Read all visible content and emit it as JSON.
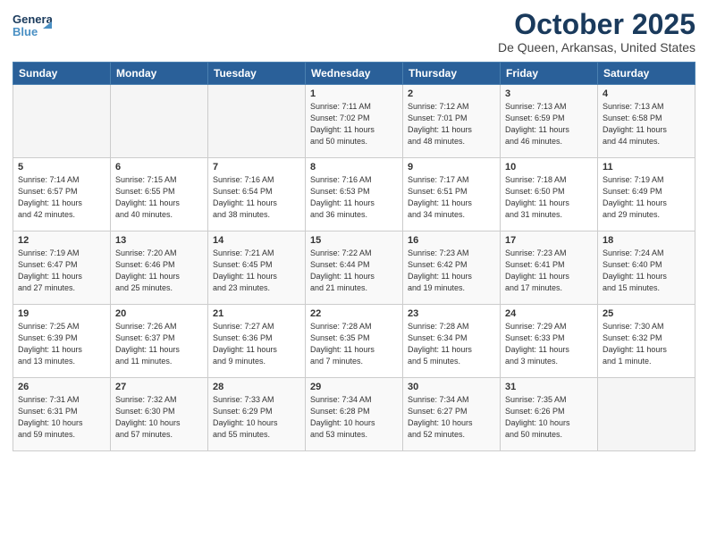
{
  "header": {
    "logo_line1": "General",
    "logo_line2": "Blue",
    "month": "October 2025",
    "location": "De Queen, Arkansas, United States"
  },
  "days_of_week": [
    "Sunday",
    "Monday",
    "Tuesday",
    "Wednesday",
    "Thursday",
    "Friday",
    "Saturday"
  ],
  "weeks": [
    [
      {
        "day": "",
        "info": ""
      },
      {
        "day": "",
        "info": ""
      },
      {
        "day": "",
        "info": ""
      },
      {
        "day": "1",
        "info": "Sunrise: 7:11 AM\nSunset: 7:02 PM\nDaylight: 11 hours\nand 50 minutes."
      },
      {
        "day": "2",
        "info": "Sunrise: 7:12 AM\nSunset: 7:01 PM\nDaylight: 11 hours\nand 48 minutes."
      },
      {
        "day": "3",
        "info": "Sunrise: 7:13 AM\nSunset: 6:59 PM\nDaylight: 11 hours\nand 46 minutes."
      },
      {
        "day": "4",
        "info": "Sunrise: 7:13 AM\nSunset: 6:58 PM\nDaylight: 11 hours\nand 44 minutes."
      }
    ],
    [
      {
        "day": "5",
        "info": "Sunrise: 7:14 AM\nSunset: 6:57 PM\nDaylight: 11 hours\nand 42 minutes."
      },
      {
        "day": "6",
        "info": "Sunrise: 7:15 AM\nSunset: 6:55 PM\nDaylight: 11 hours\nand 40 minutes."
      },
      {
        "day": "7",
        "info": "Sunrise: 7:16 AM\nSunset: 6:54 PM\nDaylight: 11 hours\nand 38 minutes."
      },
      {
        "day": "8",
        "info": "Sunrise: 7:16 AM\nSunset: 6:53 PM\nDaylight: 11 hours\nand 36 minutes."
      },
      {
        "day": "9",
        "info": "Sunrise: 7:17 AM\nSunset: 6:51 PM\nDaylight: 11 hours\nand 34 minutes."
      },
      {
        "day": "10",
        "info": "Sunrise: 7:18 AM\nSunset: 6:50 PM\nDaylight: 11 hours\nand 31 minutes."
      },
      {
        "day": "11",
        "info": "Sunrise: 7:19 AM\nSunset: 6:49 PM\nDaylight: 11 hours\nand 29 minutes."
      }
    ],
    [
      {
        "day": "12",
        "info": "Sunrise: 7:19 AM\nSunset: 6:47 PM\nDaylight: 11 hours\nand 27 minutes."
      },
      {
        "day": "13",
        "info": "Sunrise: 7:20 AM\nSunset: 6:46 PM\nDaylight: 11 hours\nand 25 minutes."
      },
      {
        "day": "14",
        "info": "Sunrise: 7:21 AM\nSunset: 6:45 PM\nDaylight: 11 hours\nand 23 minutes."
      },
      {
        "day": "15",
        "info": "Sunrise: 7:22 AM\nSunset: 6:44 PM\nDaylight: 11 hours\nand 21 minutes."
      },
      {
        "day": "16",
        "info": "Sunrise: 7:23 AM\nSunset: 6:42 PM\nDaylight: 11 hours\nand 19 minutes."
      },
      {
        "day": "17",
        "info": "Sunrise: 7:23 AM\nSunset: 6:41 PM\nDaylight: 11 hours\nand 17 minutes."
      },
      {
        "day": "18",
        "info": "Sunrise: 7:24 AM\nSunset: 6:40 PM\nDaylight: 11 hours\nand 15 minutes."
      }
    ],
    [
      {
        "day": "19",
        "info": "Sunrise: 7:25 AM\nSunset: 6:39 PM\nDaylight: 11 hours\nand 13 minutes."
      },
      {
        "day": "20",
        "info": "Sunrise: 7:26 AM\nSunset: 6:37 PM\nDaylight: 11 hours\nand 11 minutes."
      },
      {
        "day": "21",
        "info": "Sunrise: 7:27 AM\nSunset: 6:36 PM\nDaylight: 11 hours\nand 9 minutes."
      },
      {
        "day": "22",
        "info": "Sunrise: 7:28 AM\nSunset: 6:35 PM\nDaylight: 11 hours\nand 7 minutes."
      },
      {
        "day": "23",
        "info": "Sunrise: 7:28 AM\nSunset: 6:34 PM\nDaylight: 11 hours\nand 5 minutes."
      },
      {
        "day": "24",
        "info": "Sunrise: 7:29 AM\nSunset: 6:33 PM\nDaylight: 11 hours\nand 3 minutes."
      },
      {
        "day": "25",
        "info": "Sunrise: 7:30 AM\nSunset: 6:32 PM\nDaylight: 11 hours\nand 1 minute."
      }
    ],
    [
      {
        "day": "26",
        "info": "Sunrise: 7:31 AM\nSunset: 6:31 PM\nDaylight: 10 hours\nand 59 minutes."
      },
      {
        "day": "27",
        "info": "Sunrise: 7:32 AM\nSunset: 6:30 PM\nDaylight: 10 hours\nand 57 minutes."
      },
      {
        "day": "28",
        "info": "Sunrise: 7:33 AM\nSunset: 6:29 PM\nDaylight: 10 hours\nand 55 minutes."
      },
      {
        "day": "29",
        "info": "Sunrise: 7:34 AM\nSunset: 6:28 PM\nDaylight: 10 hours\nand 53 minutes."
      },
      {
        "day": "30",
        "info": "Sunrise: 7:34 AM\nSunset: 6:27 PM\nDaylight: 10 hours\nand 52 minutes."
      },
      {
        "day": "31",
        "info": "Sunrise: 7:35 AM\nSunset: 6:26 PM\nDaylight: 10 hours\nand 50 minutes."
      },
      {
        "day": "",
        "info": ""
      }
    ]
  ]
}
